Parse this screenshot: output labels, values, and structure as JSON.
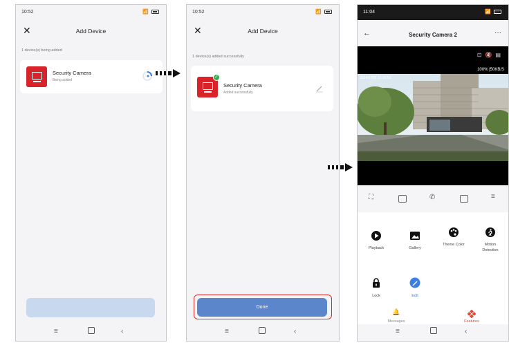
{
  "screen1": {
    "time": "10:52",
    "title": "Add Device",
    "subtitle": "1 device(s) being added",
    "device_name": "Security Camera",
    "device_status": "Being added"
  },
  "screen2": {
    "time": "10:52",
    "title": "Add Device",
    "subtitle": "1 device(s) added successfully",
    "device_name": "Security Camera",
    "device_status": "Added successfully",
    "done_label": "Done"
  },
  "screen3": {
    "time": "11:04",
    "title": "Security Camera 2",
    "overlay_timestamp": "2024/07/01 11:29:52",
    "signal_text": "100% |50KB/S",
    "features": [
      {
        "label": "Playback",
        "icon": "playback-icon"
      },
      {
        "label": "Gallery",
        "icon": "gallery-icon"
      },
      {
        "label": "Theme Color",
        "icon": "palette-icon"
      },
      {
        "label": "Motion Detection",
        "icon": "motion-icon"
      },
      {
        "label": "Lock",
        "icon": "lock-icon"
      },
      {
        "label": "Edit",
        "icon": "edit-icon"
      }
    ],
    "bottom_tabs": [
      {
        "label": "Messages",
        "icon": "bell-icon"
      },
      {
        "label": "Features",
        "icon": "features-icon"
      }
    ]
  },
  "colors": {
    "accent_red": "#d8232a",
    "button_blue": "#5b86cc",
    "highlight_red": "#d62a2a",
    "edit_blue": "#3b7fe0"
  }
}
